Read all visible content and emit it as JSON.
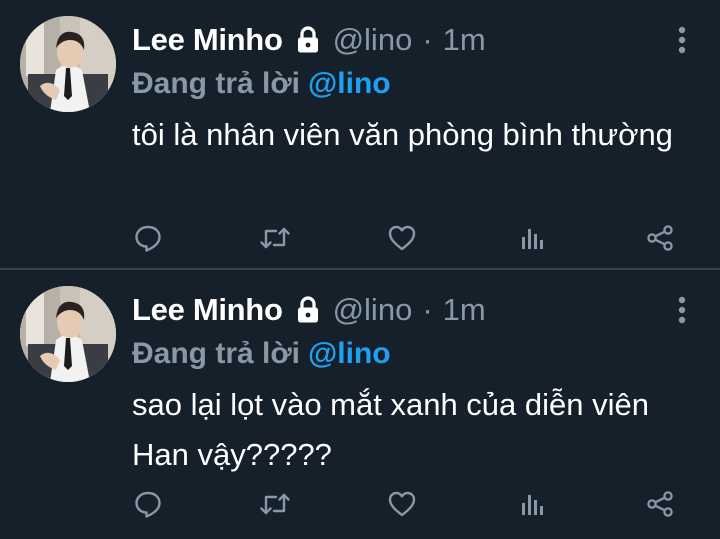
{
  "tweets": [
    {
      "author_name": "Lee Minho",
      "handle": "@lino",
      "separator": "·",
      "time": "1m",
      "reply_prefix": "Đang trả lời",
      "reply_to": "@lino",
      "text": "tôi là nhân viên văn phòng bình thường"
    },
    {
      "author_name": "Lee Minho",
      "handle": "@lino",
      "separator": "·",
      "time": "1m",
      "reply_prefix": "Đang trả lời",
      "reply_to": "@lino",
      "text": "sao lại lọt vào mắt xanh của diễn viên Han vậy?????"
    }
  ],
  "icons": {
    "protected": "lock-icon",
    "more": "more-vertical-icon",
    "reply": "comment-icon",
    "retweet": "retweet-icon",
    "like": "heart-icon",
    "stats": "bar-chart-icon",
    "share": "share-icon"
  },
  "colors": {
    "background": "#15202b",
    "divider": "#38444d",
    "text_primary": "#ffffff",
    "text_secondary": "#8899a6",
    "link": "#1da1f2"
  }
}
